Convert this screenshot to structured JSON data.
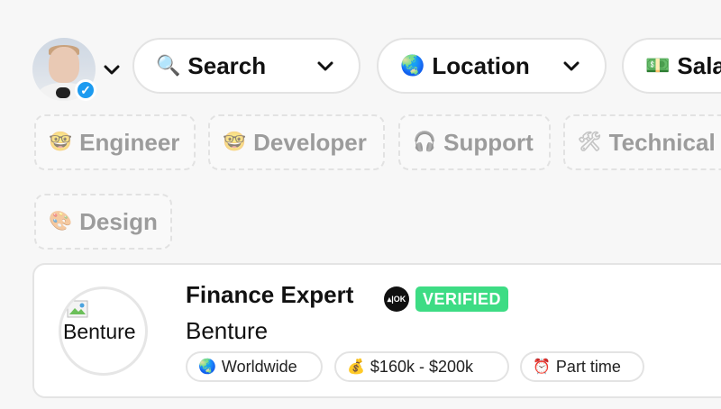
{
  "filters": {
    "search": {
      "icon": "magnifier-icon",
      "emoji": "🔍",
      "label": "Search"
    },
    "location": {
      "icon": "globe-icon",
      "emoji": "🌏",
      "label": "Location"
    },
    "salary": {
      "icon": "money-icon",
      "emoji": "💵",
      "label": "Sala"
    }
  },
  "tags": [
    {
      "emoji": "🤓",
      "label": "Engineer"
    },
    {
      "emoji": "🤓",
      "label": "Developer"
    },
    {
      "emoji": "🎧",
      "label": "Support"
    },
    {
      "emoji": "🛠",
      "label": "Technical"
    },
    {
      "emoji": "🎨",
      "label": "Design"
    }
  ],
  "job": {
    "title": "Finance Expert",
    "company_mark": "▴|OK",
    "verified_label": "VERIFIED",
    "company": "Benture",
    "logo_alt": "Benture",
    "meta": [
      {
        "emoji": "🌏",
        "label": "Worldwide"
      },
      {
        "emoji": "💰",
        "label": "$160k - $200k"
      },
      {
        "emoji": "⏰",
        "label": "Part time"
      }
    ]
  },
  "colors": {
    "verified_green": "#3ddc84",
    "badge_blue": "#1d9bf0",
    "tag_text": "#9c9c9c"
  }
}
